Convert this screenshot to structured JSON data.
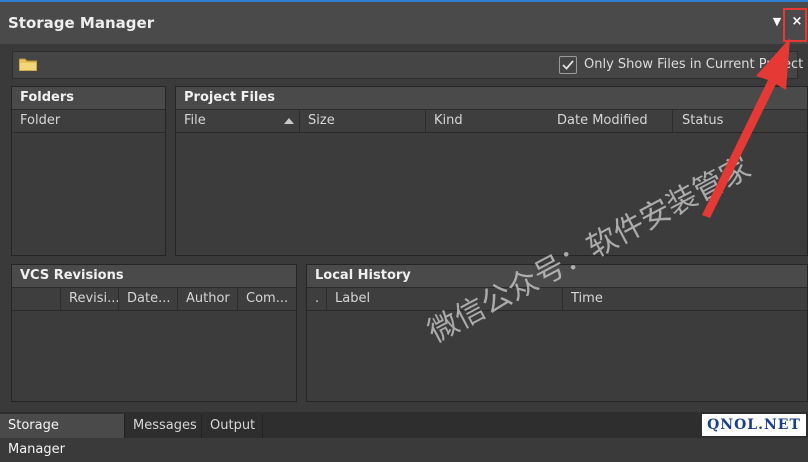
{
  "window": {
    "title": "Storage Manager",
    "menu_icon": "dropdown-arrow-icon",
    "close_label": "×"
  },
  "toolbar": {
    "folder_icon": "folder-icon",
    "checkbox_checked": true,
    "checkbox_label": "Only Show Files in Current Project"
  },
  "folders": {
    "title": "Folders",
    "columns": [
      "Folder"
    ]
  },
  "project_files": {
    "title": "Project Files",
    "columns": [
      "File",
      "Size",
      "Kind",
      "Date Modified",
      "Status"
    ],
    "sorted_column": "File"
  },
  "vcs": {
    "title": "VCS Revisions",
    "columns": [
      "",
      "Revisi...",
      "Date...",
      "Author",
      "Com..."
    ]
  },
  "local_history": {
    "title": "Local History",
    "columns": [
      ".",
      "Label",
      "Time"
    ]
  },
  "tabs": [
    {
      "label": "Storage Manager",
      "active": true
    },
    {
      "label": "Messages",
      "active": false
    },
    {
      "label": "Output",
      "active": false
    }
  ],
  "watermark": {
    "text": "微信公众号：软件安装管家"
  },
  "logo": {
    "text": "QNOL.NET"
  },
  "colors": {
    "accent_blue": "#2f7fd1",
    "highlight_red": "#e53935",
    "background": "#3a3a3a",
    "header_bg": "#4a4a4a"
  }
}
